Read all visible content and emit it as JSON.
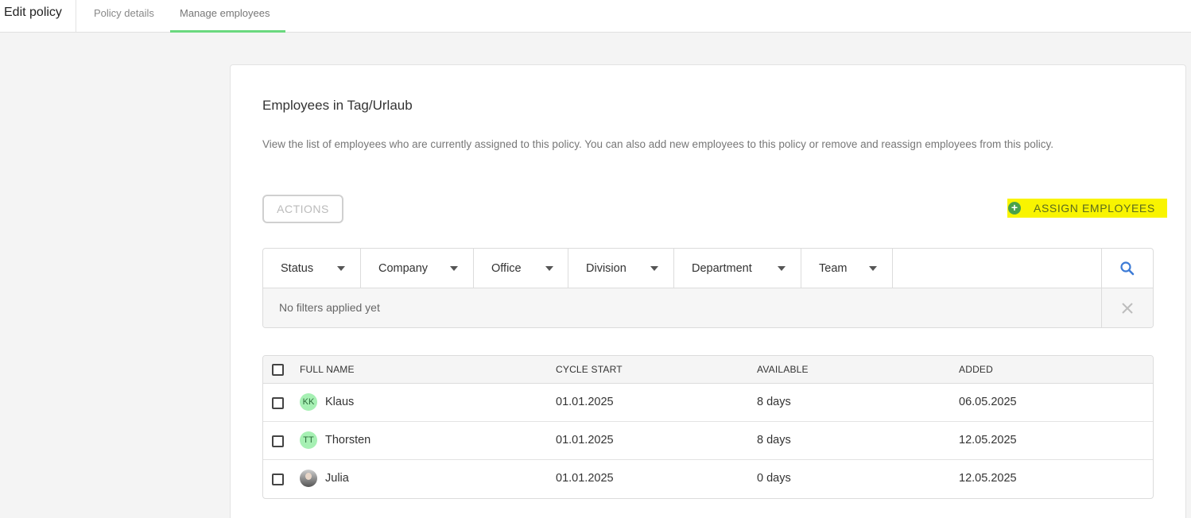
{
  "header": {
    "title": "Edit policy",
    "tabs": [
      {
        "label": "Policy details",
        "active": false
      },
      {
        "label": "Manage employees",
        "active": true
      }
    ],
    "active_tab_color": "#6ad87e"
  },
  "card": {
    "title": "Employees in Tag/Urlaub",
    "description": "View the list of employees who are currently assigned to this policy. You can also add new employees to this policy or remove and reassign employees from this policy.",
    "actions_label": "ACTIONS",
    "assign_label": "ASSIGN EMPLOYEES",
    "assign_highlight_color": "#f9f400"
  },
  "filters": {
    "items": [
      {
        "label": "Status"
      },
      {
        "label": "Company"
      },
      {
        "label": "Office"
      },
      {
        "label": "Division"
      },
      {
        "label": "Department"
      },
      {
        "label": "Team"
      }
    ],
    "empty_text": "No filters applied yet",
    "search_icon": "search-icon",
    "clear_icon": "close-icon"
  },
  "table": {
    "columns": [
      "FULL NAME",
      "CYCLE START",
      "AVAILABLE",
      "ADDED"
    ],
    "rows": [
      {
        "initials": "KK",
        "name": "Klaus",
        "cycle_start": "01.01.2025",
        "available": "8 days",
        "added": "06.05.2025"
      },
      {
        "initials": "TT",
        "name": "Thorsten",
        "cycle_start": "01.01.2025",
        "available": "8 days",
        "added": "12.05.2025"
      },
      {
        "initials": "",
        "name": "Julia",
        "cycle_start": "01.01.2025",
        "available": "0 days",
        "added": "12.05.2025"
      }
    ]
  }
}
